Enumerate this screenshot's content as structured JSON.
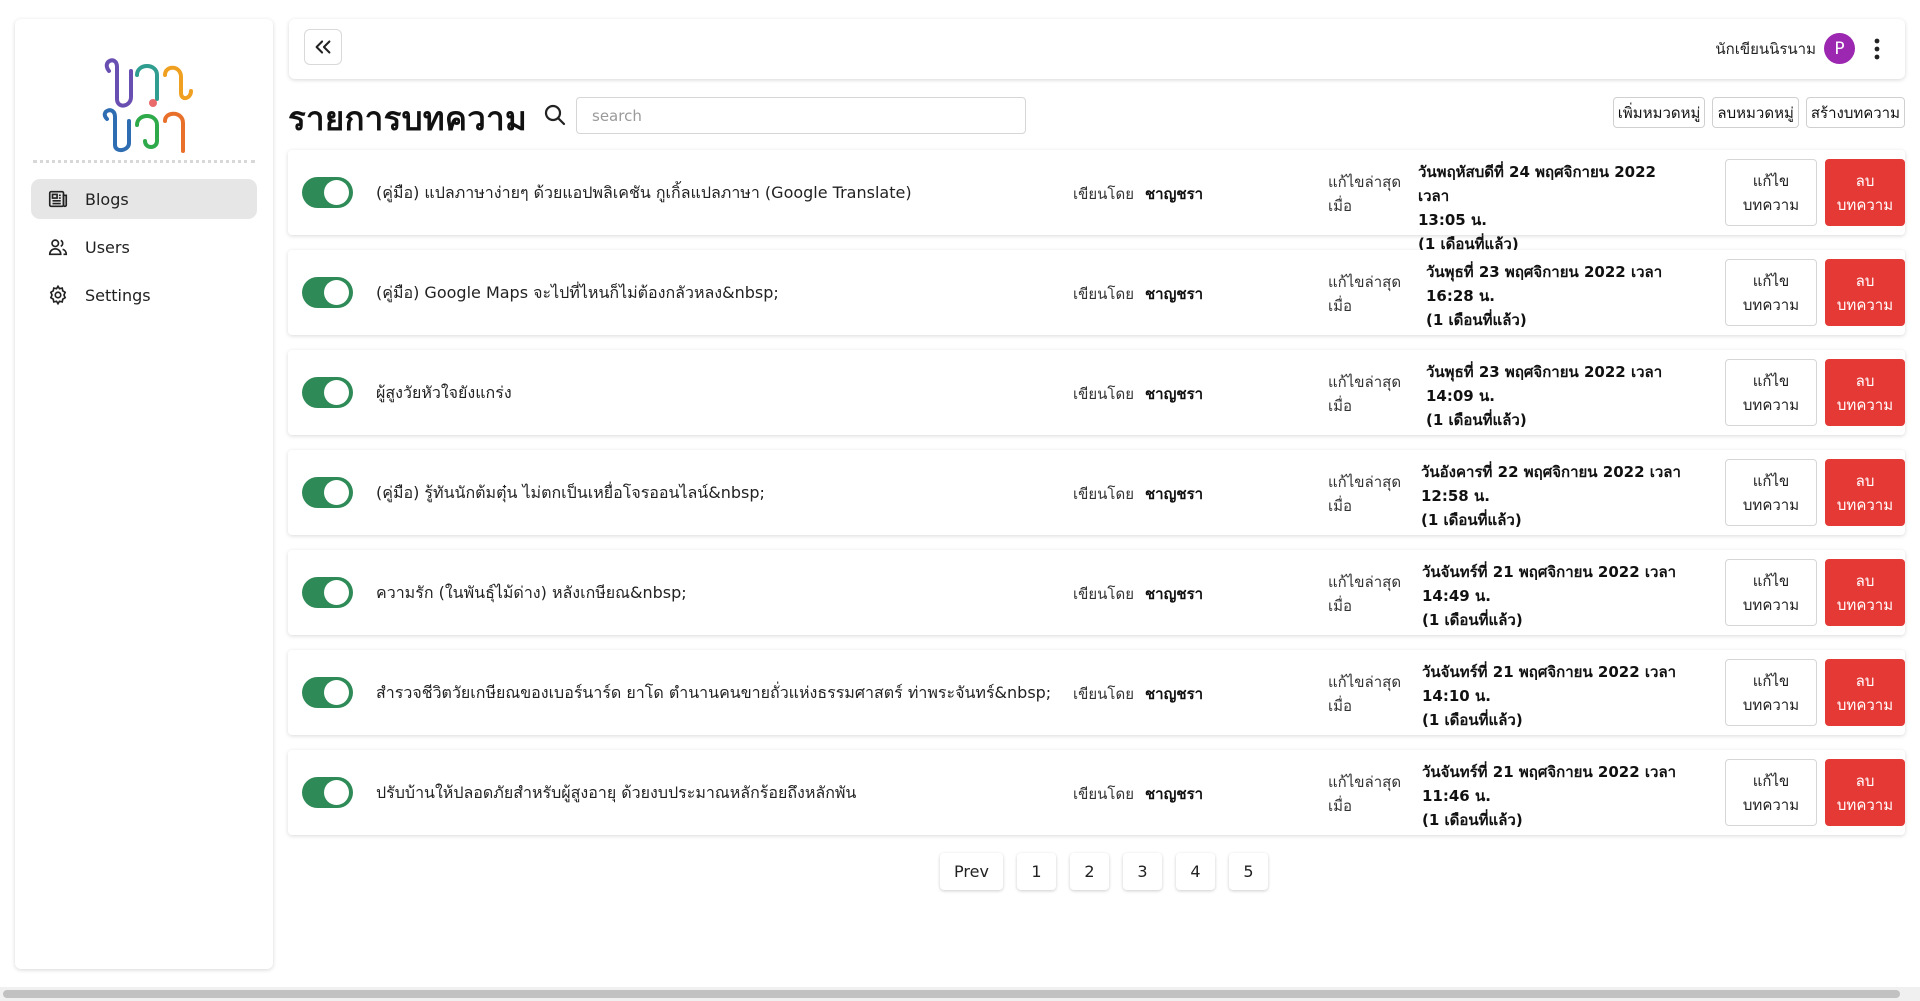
{
  "sidebar": {
    "logo_text": "ชาญชรา",
    "items": [
      {
        "label": "Blogs",
        "icon": "newspaper-icon",
        "active": true
      },
      {
        "label": "Users",
        "icon": "users-icon",
        "active": false
      },
      {
        "label": "Settings",
        "icon": "gear-icon",
        "active": false
      }
    ]
  },
  "header": {
    "user_name": "นักเขียนนิรนาม",
    "avatar_letter": "P",
    "avatar_color": "#9c27b0"
  },
  "page": {
    "title": "รายการบทความ",
    "search_placeholder": "search",
    "toolbar": {
      "add_category": "เพิ่มหมวดหมู่",
      "delete_category": "ลบหมวดหมู่",
      "create_article": "สร้างบทความ"
    }
  },
  "labels": {
    "written_by": "เขียนโดย",
    "last_modified_line1": "แก้ไขล่าสุด",
    "last_modified_line2": "เมื่อ",
    "edit_line1": "แก้ไข",
    "edit_line2": "บทความ",
    "delete_line1": "ลบ",
    "delete_line2": "บทความ"
  },
  "colors": {
    "toggle_on": "#2e8b57",
    "delete_button": "#e53935"
  },
  "articles": [
    {
      "published": true,
      "title": "(คู่มือ) แปลภาษาง่ายๆ ด้วยแอปพลิเคชัน กูเกิ้ลแปลภาษา (Google Translate)",
      "author": "ชาญชรา",
      "date_line1": "วันพฤหัสบดีที่ 24 พฤศจิกายน 2022 เวลา",
      "date_line2": "13:05 น.",
      "date_line3": "(1 เดือนที่แล้ว)"
    },
    {
      "published": true,
      "title": "(คู่มือ) Google Maps จะไปที่ไหนก็ไม่ต้องกลัวหลง&nbsp;",
      "author": "ชาญชรา",
      "date_line1": "วันพุธที่ 23 พฤศจิกายน 2022 เวลา",
      "date_line2": "16:28 น.",
      "date_line3": "(1 เดือนที่แล้ว)"
    },
    {
      "published": true,
      "title": "ผู้สูงวัยหัวใจยังแกร่ง",
      "author": "ชาญชรา",
      "date_line1": "วันพุธที่ 23 พฤศจิกายน 2022 เวลา",
      "date_line2": "14:09 น.",
      "date_line3": "(1 เดือนที่แล้ว)"
    },
    {
      "published": true,
      "title": "(คู่มือ) รู้ทันนักต้มตุ๋น ไม่ตกเป็นเหยื่อโจรออนไลน์&nbsp;",
      "author": "ชาญชรา",
      "date_line1": "วันอังคารที่ 22 พฤศจิกายน 2022 เวลา",
      "date_line2": "12:58 น.",
      "date_line3": "(1 เดือนที่แล้ว)"
    },
    {
      "published": true,
      "title": "ความรัก (ในพันธุ์ไม้ด่าง) หลังเกษียณ&nbsp;",
      "author": "ชาญชรา",
      "date_line1": "วันจันทร์ที่ 21 พฤศจิกายน 2022 เวลา",
      "date_line2": "14:49 น.",
      "date_line3": "(1 เดือนที่แล้ว)"
    },
    {
      "published": true,
      "title": "สำรวจชีวิตวัยเกษียณของเบอร์นาร์ด ยาโด ตำนานคนขายถั่วแห่งธรรมศาสตร์ ท่าพระจันทร์&nbsp;",
      "author": "ชาญชรา",
      "date_line1": "วันจันทร์ที่ 21 พฤศจิกายน 2022 เวลา",
      "date_line2": "14:10 น.",
      "date_line3": "(1 เดือนที่แล้ว)"
    },
    {
      "published": true,
      "title": "ปรับบ้านให้ปลอดภัยสำหรับผู้สูงอายุ ด้วยงบประมาณหลักร้อยถึงหลักพัน",
      "author": "ชาญชรา",
      "date_line1": "วันจันทร์ที่ 21 พฤศจิกายน 2022 เวลา",
      "date_line2": "11:46 น.",
      "date_line3": "(1 เดือนที่แล้ว)"
    }
  ],
  "pagination": {
    "prev_label": "Prev",
    "pages": [
      "1",
      "2",
      "3",
      "4",
      "5"
    ]
  }
}
